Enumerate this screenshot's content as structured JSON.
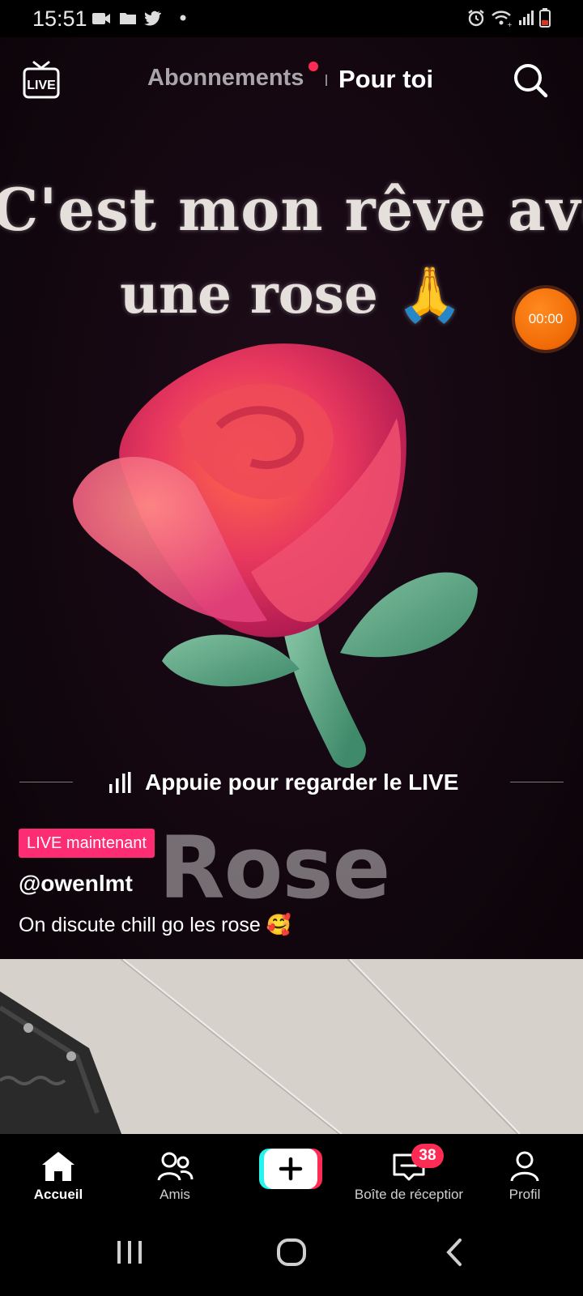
{
  "status_bar": {
    "time": "15:51"
  },
  "top_nav": {
    "live_label": "LIVE",
    "tab_following": "Abonnements",
    "tab_for_you": "Pour toi"
  },
  "video": {
    "overlay_line1": "C'est mon rêve avoir",
    "overlay_line2": "une rose 🙏",
    "timer": "00:00",
    "cta_text": "Appuie pour regarder le LIVE",
    "live_badge": "LIVE maintenant",
    "watermark": "Rose",
    "username": "@owenlmt",
    "caption": "On discute chill go les rose 🥰"
  },
  "bottom_nav": {
    "home": "Accueil",
    "friends": "Amis",
    "inbox": "Boîte de réceptior",
    "inbox_count": "38",
    "profile": "Profil"
  },
  "colors": {
    "accent_red": "#fe2c55",
    "live_pink": "#fe2c73",
    "timer_orange": "#f06a06"
  }
}
